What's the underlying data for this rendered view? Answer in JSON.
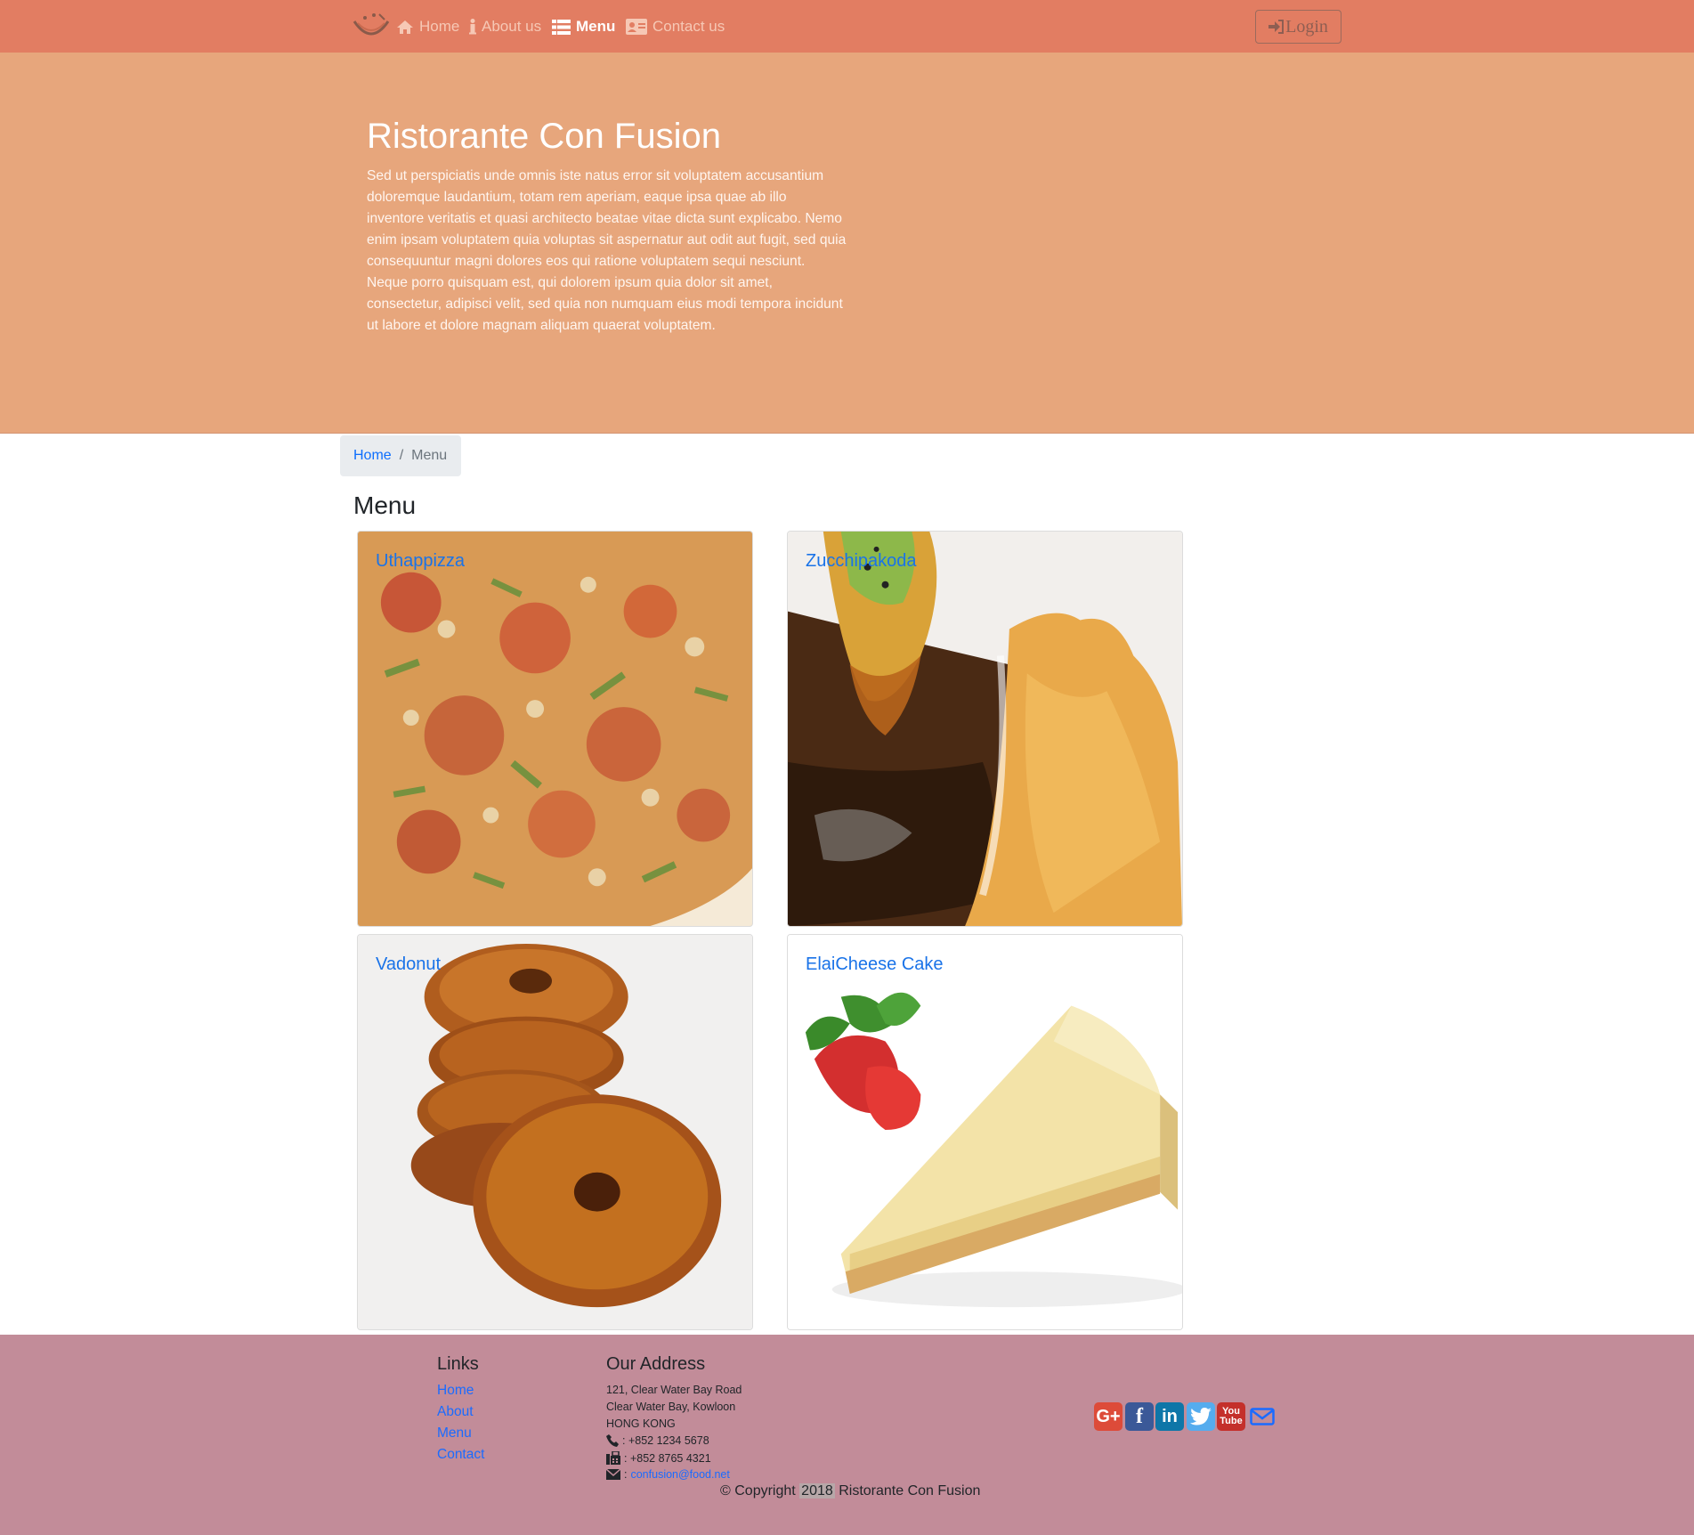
{
  "navbar": {
    "items": [
      {
        "label": "Home",
        "icon": "home-icon"
      },
      {
        "label": "About us",
        "icon": "info-icon"
      },
      {
        "label": "Menu",
        "icon": "list-icon",
        "active": true
      },
      {
        "label": "Contact us",
        "icon": "address-card-icon"
      }
    ],
    "login_label": "Login"
  },
  "jumbotron": {
    "title": "Ristorante Con Fusion",
    "text": "Sed ut perspiciatis unde omnis iste natus error sit voluptatem accusantium doloremque laudantium, totam rem aperiam, eaque ipsa quae ab illo inventore veritatis et quasi architecto beatae vitae dicta sunt explicabo. Nemo enim ipsam voluptatem quia voluptas sit aspernatur aut odit aut fugit, sed quia consequuntur magni dolores eos qui ratione voluptatem sequi nesciunt. Neque porro quisquam est, qui dolorem ipsum quia dolor sit amet, consectetur, adipisci velit, sed quia non numquam eius modi tempora incidunt ut labore et dolore magnam aliquam quaerat voluptatem."
  },
  "breadcrumb": {
    "home": "Home",
    "separator": "/",
    "current": "Menu"
  },
  "page_heading": "Menu",
  "dishes": [
    {
      "name": "Uthappizza"
    },
    {
      "name": "Zucchipakoda"
    },
    {
      "name": "Vadonut"
    },
    {
      "name": "ElaiCheese Cake"
    }
  ],
  "footer": {
    "links_heading": "Links",
    "links": [
      "Home",
      "About",
      "Menu",
      "Contact"
    ],
    "address_heading": "Our Address",
    "address_lines": [
      "121, Clear Water Bay Road",
      "Clear Water Bay, Kowloon",
      "HONG KONG"
    ],
    "phone": ": +852 1234 5678",
    "fax": ": +852 8765 4321",
    "email_prefix": ":",
    "email": "confusion@food.net",
    "social": [
      "google-plus-icon",
      "facebook-icon",
      "linkedin-icon",
      "twitter-icon",
      "youtube-icon",
      "envelope-icon"
    ],
    "copyright_prefix": "© Copyright",
    "copyright_year": "2018",
    "copyright_suffix": "Ristorante Con Fusion"
  },
  "colors": {
    "navbar": "#e27d62",
    "jumbotron": "#e7a67c",
    "footer": "#c28c99",
    "link": "#1a73e8"
  }
}
